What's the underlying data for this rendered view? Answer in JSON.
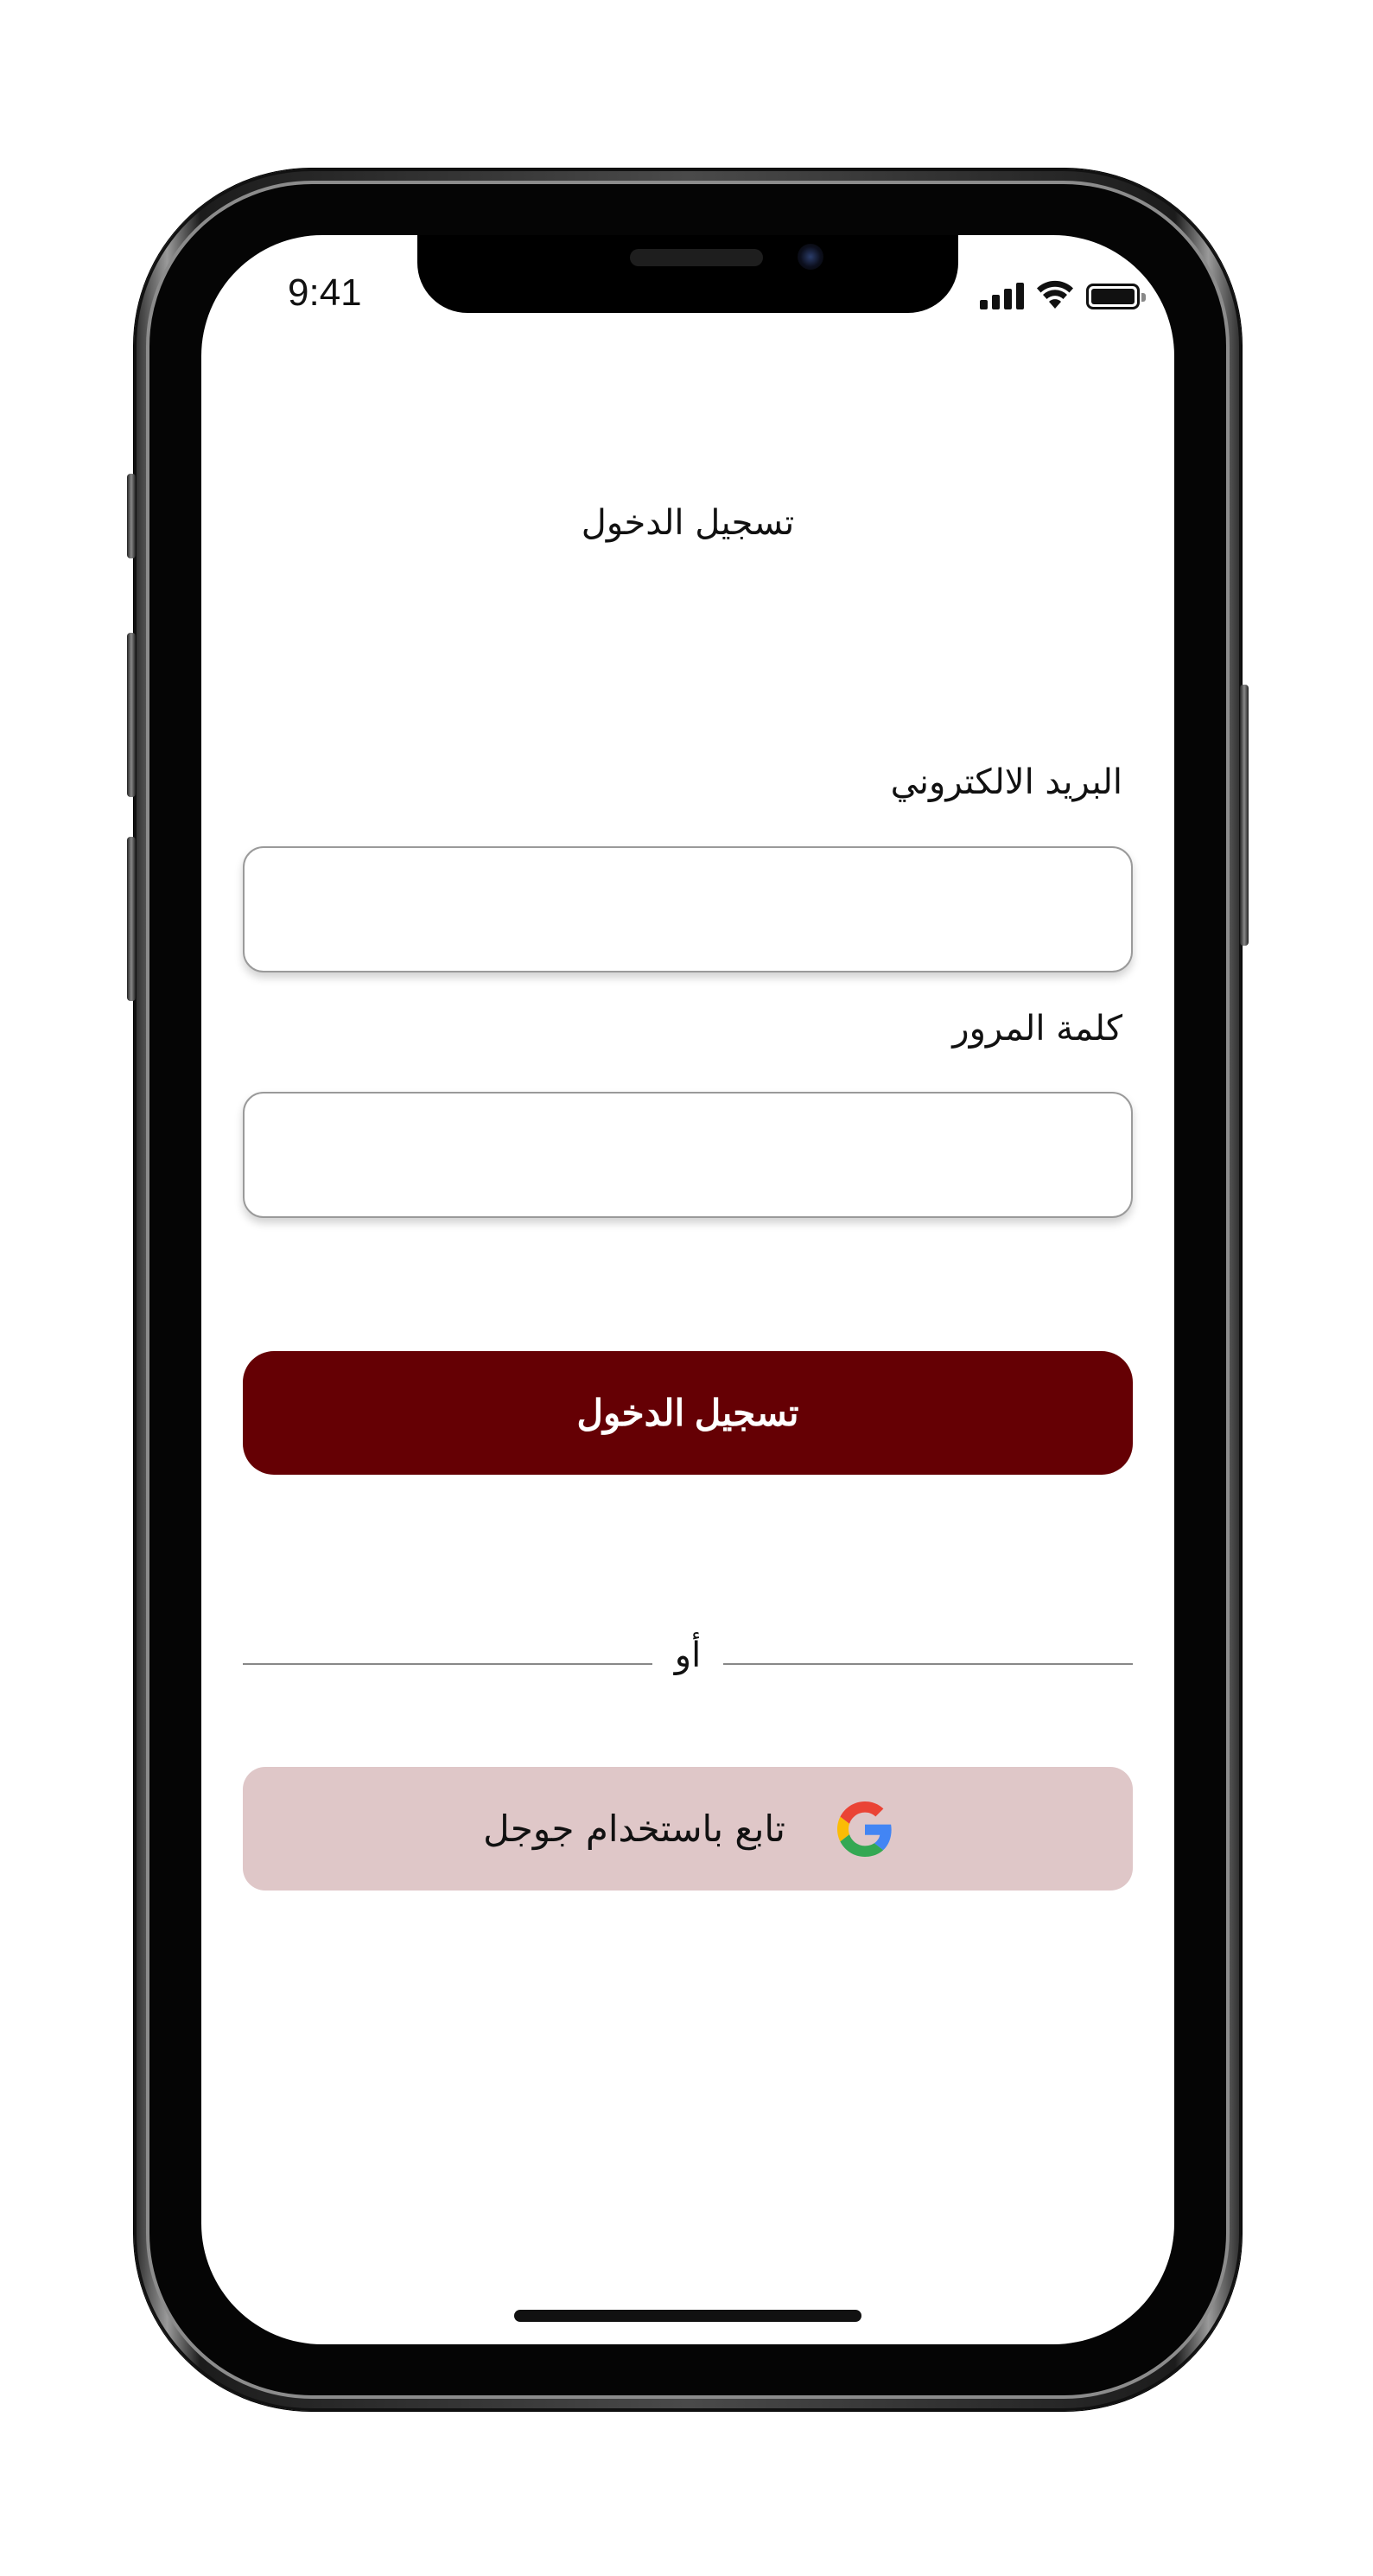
{
  "status_bar": {
    "time": "9:41",
    "icons": [
      "cellular-signal-icon",
      "wifi-icon",
      "battery-icon"
    ]
  },
  "page": {
    "title": "تسجيل الدخول"
  },
  "form": {
    "email_label": "البريد الالكتروني",
    "email_value": "",
    "password_label": "كلمة المرور",
    "password_value": "",
    "login_button_label": "تسجيل الدخول",
    "divider_text": "أو",
    "google_button_label": "تابع باستخدام جوجل"
  },
  "colors": {
    "primary": "#650004",
    "google_button_bg": "#dfc7c8",
    "google_blue": "#4285F4",
    "google_red": "#EA4335",
    "google_yellow": "#FBBC05",
    "google_green": "#34A853"
  }
}
